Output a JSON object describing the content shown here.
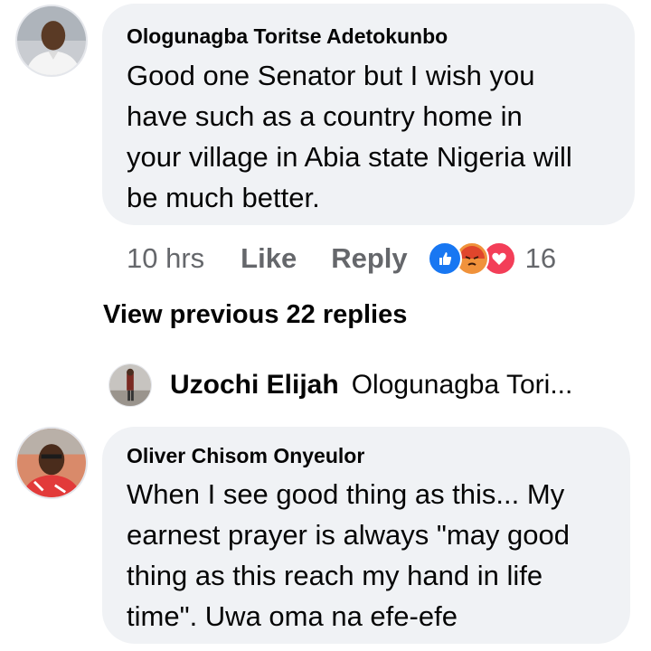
{
  "comments": [
    {
      "author": "Ologunagba Toritse Adetokunbo",
      "lines": [
        "Good one Senator but I wish you",
        "have such as a country home in",
        "your village in Abia state Nigeria will",
        "be much better."
      ],
      "time": "10 hrs",
      "like_label": "Like",
      "reply_label": "Reply",
      "reaction_icons": [
        "like-icon",
        "angry-icon",
        "love-icon"
      ],
      "reaction_count": "16"
    },
    {
      "author": "Oliver Chisom Onyeulor",
      "lines": [
        "When I see good thing as this... My",
        "earnest prayer is always \"may good",
        "thing as this reach my hand in life",
        "time\". Uwa oma na efe-efe"
      ]
    }
  ],
  "view_previous": "View previous 22 replies",
  "reply_preview": {
    "author": "Uzochi Elijah",
    "snippet": "Ologunagba Tori..."
  },
  "colors": {
    "bubble": "#f0f2f5",
    "meta_text": "#65676b",
    "like_blue": "#1877f2",
    "angry_orange": "#f0923b",
    "love_red": "#f33e58"
  }
}
